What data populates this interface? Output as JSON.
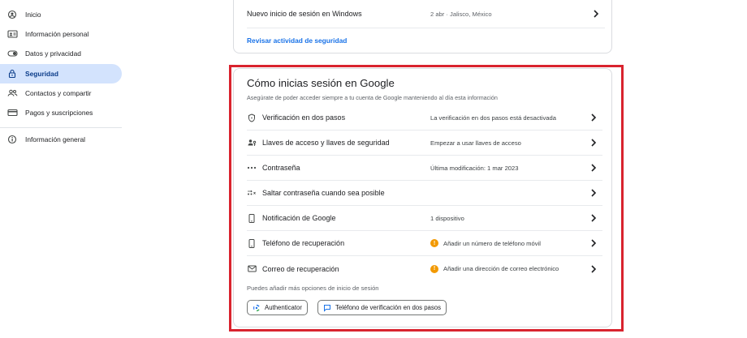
{
  "sidebar": {
    "items": [
      {
        "label": "Inicio",
        "icon": "home-icon"
      },
      {
        "label": "Información personal",
        "icon": "id-card-icon"
      },
      {
        "label": "Datos y privacidad",
        "icon": "toggle-icon"
      },
      {
        "label": "Seguridad",
        "icon": "lock-icon"
      },
      {
        "label": "Contactos y compartir",
        "icon": "people-icon"
      },
      {
        "label": "Pagos y suscripciones",
        "icon": "credit-card-icon"
      },
      {
        "label": "Información general",
        "icon": "info-icon"
      }
    ],
    "active_index": 3
  },
  "recent_activity": {
    "row": {
      "label": "Nuevo inicio de sesión en Windows",
      "value": "2 abr · Jalisco, México"
    },
    "review_link": "Revisar actividad de seguridad"
  },
  "signin": {
    "title": "Cómo inicias sesión en Google",
    "subtitle": "Asegúrate de poder acceder siempre a tu cuenta de Google manteniendo al día esta información",
    "options": [
      {
        "label": "Verificación en dos pasos",
        "value": "La verificación en dos pasos está desactivada",
        "icon": "shield-icon",
        "warning": false
      },
      {
        "label": "Llaves de acceso y llaves de seguridad",
        "value": "Empezar a usar llaves de acceso",
        "icon": "passkey-icon",
        "warning": false
      },
      {
        "label": "Contraseña",
        "value": "Última modificación: 1 mar 2023",
        "icon": "password-dots-icon",
        "warning": false
      },
      {
        "label": "Saltar contraseña cuando sea posible",
        "value": "",
        "icon": "skip-password-icon",
        "warning": false
      },
      {
        "label": "Notificación de Google",
        "value": "1 dispositivo",
        "icon": "phone-icon",
        "warning": false
      },
      {
        "label": "Teléfono de recuperación",
        "value": "Añadir un número de teléfono móvil",
        "icon": "phone-icon",
        "warning": true
      },
      {
        "label": "Correo de recuperación",
        "value": "Añadir una dirección de correo electrónico",
        "icon": "mail-icon",
        "warning": true
      }
    ],
    "more_text": "Puedes añadir más opciones de inicio de sesión",
    "chips": [
      {
        "label": "Authenticator",
        "icon": "authenticator-icon"
      },
      {
        "label": "Teléfono de verificación en dos pasos",
        "icon": "message-icon"
      }
    ]
  },
  "colors": {
    "active_nav_bg": "#d3e3fd",
    "link": "#1a73e8",
    "highlight_border": "#d9232e",
    "warning": "#f29900"
  }
}
